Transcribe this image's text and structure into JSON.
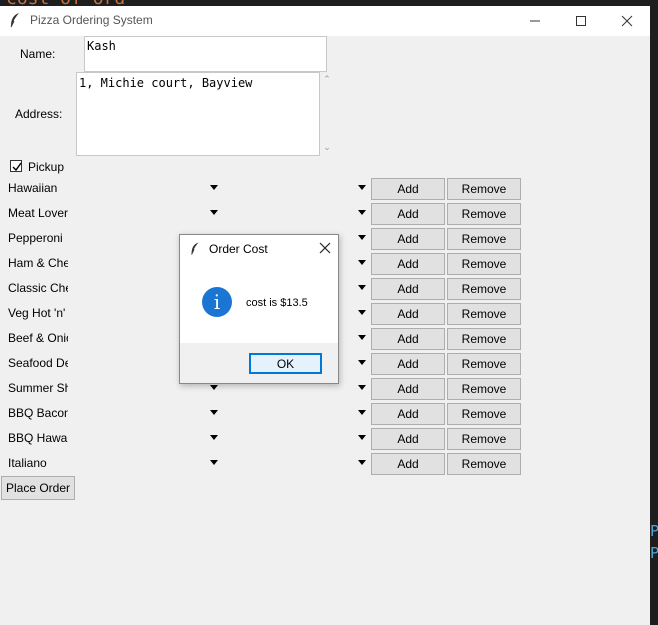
{
  "background": {
    "snippet_text": "cost of ord",
    "edge_text": "P P"
  },
  "window": {
    "title": "Pizza Ordering System",
    "title_icon": "feather-icon",
    "controls": [
      "minimize-icon",
      "maximize-icon",
      "close-icon"
    ]
  },
  "form": {
    "name_label": "Name:",
    "name_value": "Kash",
    "address_label": "Address:",
    "address_value": "1, Michie court, Bayview",
    "pickup_label": "Pickup",
    "pickup_checked": true
  },
  "pizzas": [
    {
      "name": "Hawaiian"
    },
    {
      "name": "Meat Lover"
    },
    {
      "name": "Pepperoni"
    },
    {
      "name": "Ham & Che"
    },
    {
      "name": "Classic Che"
    },
    {
      "name": "Veg Hot 'n'"
    },
    {
      "name": "Beef & Onio"
    },
    {
      "name": "Seafood De"
    },
    {
      "name": "Summer Sh"
    },
    {
      "name": "BBQ Bacon"
    },
    {
      "name": "BBQ Hawai"
    },
    {
      "name": "Italiano"
    }
  ],
  "buttons": {
    "add_label": "Add",
    "remove_label": "Remove",
    "place_order_label": "Place Order"
  },
  "dialog": {
    "title": "Order Cost",
    "message": "cost is $13.5",
    "ok_label": "OK",
    "icon": "info-icon"
  },
  "colors": {
    "window_bg": "#f0f0f0",
    "info_blue": "#1a76d2",
    "focus_border": "#0078d7"
  }
}
